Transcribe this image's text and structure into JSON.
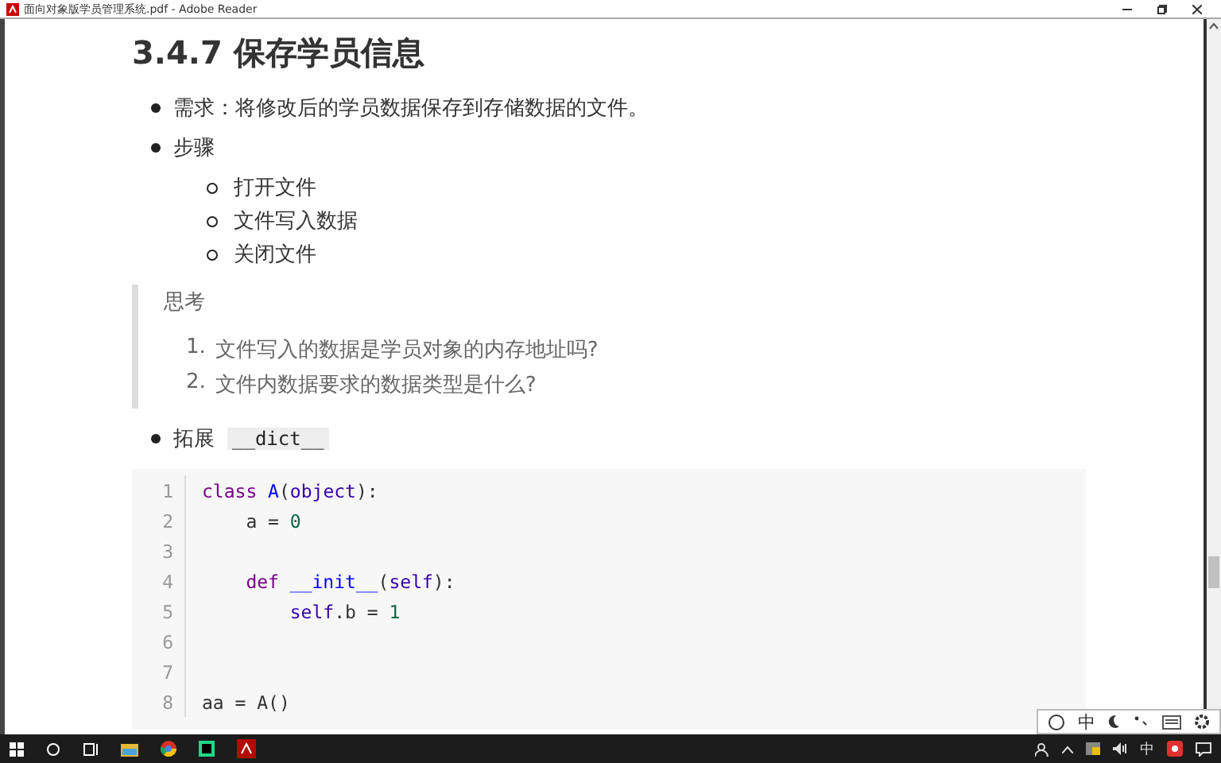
{
  "window": {
    "title": "面向对象版学员管理系统.pdf - Adobe Reader"
  },
  "heading": "3.4.7 保存学员信息",
  "bullets": [
    {
      "text": "需求：将修改后的学员数据保存到存储数据的文件。"
    },
    {
      "text": "步骤",
      "children": [
        "打开文件",
        "文件写入数据",
        "关闭文件"
      ]
    }
  ],
  "quote": {
    "title": "思考",
    "items": [
      {
        "number": "1.",
        "text": "文件写入的数据是学员对象的内存地址吗?"
      },
      {
        "number": "2.",
        "text": "文件内数据要求的数据类型是什么?"
      }
    ]
  },
  "extend": {
    "text": "拓展",
    "code": "__dict__"
  },
  "code": [
    {
      "number": "1",
      "tokens": [
        {
          "kind": "keyword",
          "text": "class"
        },
        {
          "kind": "def",
          "text": " A"
        },
        {
          "kind": "plain",
          "text": "("
        },
        {
          "kind": "builtin",
          "text": "object"
        },
        {
          "kind": "plain",
          "text": "):"
        }
      ]
    },
    {
      "number": "2",
      "tokens": [
        {
          "kind": "plain",
          "text": "    a = "
        },
        {
          "kind": "number",
          "text": "0"
        }
      ]
    },
    {
      "number": "3"
    },
    {
      "number": "4",
      "tokens": [
        {
          "kind": "keyword",
          "text": "    def"
        },
        {
          "kind": "def",
          "text": " __init__"
        },
        {
          "kind": "plain",
          "text": "("
        },
        {
          "kind": "builtin",
          "text": "self"
        },
        {
          "kind": "plain",
          "text": "):"
        }
      ]
    },
    {
      "number": "5",
      "tokens": [
        {
          "kind": "builtin",
          "text": "        self"
        },
        {
          "kind": "plain",
          "text": ".b = "
        },
        {
          "kind": "number",
          "text": "1"
        }
      ]
    },
    {
      "number": "6"
    },
    {
      "number": "7"
    },
    {
      "number": "8",
      "tokens": [
        {
          "kind": "plain",
          "text": "aa = A()"
        }
      ]
    }
  ],
  "ime": {
    "mode": "中"
  },
  "tray": {
    "ime": "中"
  }
}
